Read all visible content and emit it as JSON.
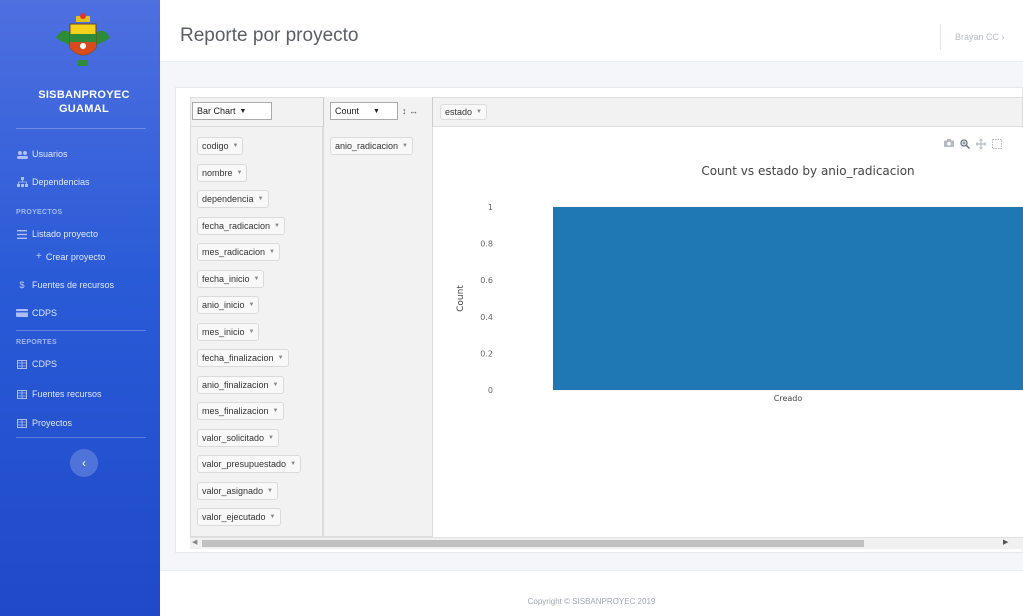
{
  "app": {
    "brand_line1": "SISBANPROYEC",
    "brand_line2": "GUAMAL",
    "page_title": "Reporte por proyecto",
    "user_name": "Brayan CC",
    "footer": "Copyright © SISBANPROYEC 2019"
  },
  "sidebar": {
    "items": [
      {
        "label": "Usuarios",
        "icon": "users-icon"
      },
      {
        "label": "Dependencias",
        "icon": "sitemap-icon"
      }
    ],
    "section_proyectos": "PROYECTOS",
    "proyectos_items": [
      {
        "label": "Listado proyecto",
        "icon": "list-icon"
      }
    ],
    "crear_proyecto": "Crear proyecto",
    "after_items": [
      {
        "label": "Fuentes de recursos",
        "icon": "dollar-icon"
      },
      {
        "label": "CDPS",
        "icon": "card-icon"
      }
    ],
    "section_reportes": "REPORTES",
    "reportes_items": [
      {
        "label": "CDPS",
        "icon": "table-icon"
      },
      {
        "label": "Fuentes recursos",
        "icon": "table-icon"
      },
      {
        "label": "Proyectos",
        "icon": "table-icon"
      }
    ]
  },
  "pivot": {
    "renderer": "Bar Chart",
    "aggregator": "Count",
    "sort_icons": "↕ ↔",
    "column_attr": "estado",
    "row_attr": "anio_radicacion",
    "attributes": [
      "codigo",
      "nombre",
      "dependencia",
      "fecha_radicacion",
      "mes_radicacion",
      "fecha_inicio",
      "anio_inicio",
      "mes_inicio",
      "fecha_finalizacion",
      "anio_finalizacion",
      "mes_finalizacion",
      "valor_solicitado",
      "valor_presupuestado",
      "valor_asignado",
      "valor_ejecutado"
    ]
  },
  "chart_data": {
    "type": "bar",
    "title": "Count vs estado by anio_radicacion",
    "xlabel": "",
    "ylabel": "Count",
    "categories": [
      "Creado"
    ],
    "values": [
      1
    ],
    "yticks": [
      "0",
      "0.2",
      "0.4",
      "0.6",
      "0.8",
      "1"
    ],
    "ylim": [
      0,
      1
    ],
    "bar_color": "#1f77b4",
    "grid": true
  },
  "colors": {
    "sidebar": "#2a5bd7",
    "bar": "#1f77b4"
  }
}
